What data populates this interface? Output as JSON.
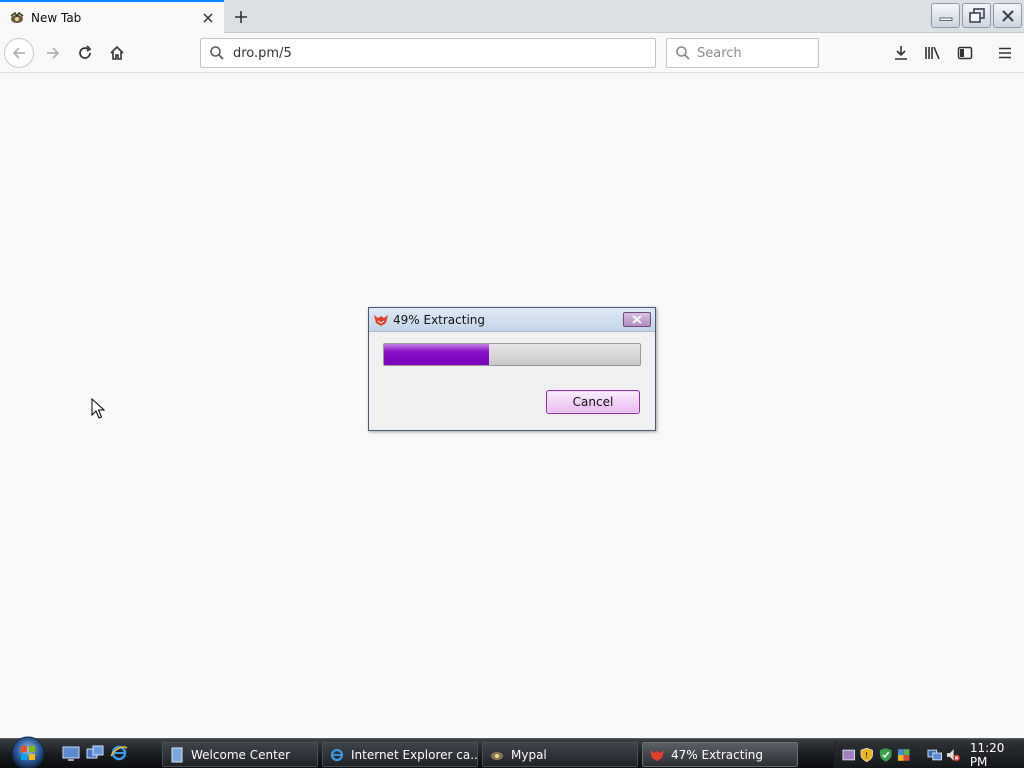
{
  "browser": {
    "tab": {
      "title": "New Tab",
      "close_icon": "close-icon",
      "favicon": "mypal-icon"
    },
    "new_tab_icon": "plus-icon",
    "nav": {
      "back_icon": "back-arrow-icon",
      "forward_icon": "forward-arrow-icon",
      "reload_icon": "reload-icon",
      "home_icon": "home-icon"
    },
    "url": {
      "value": "dro.pm/5"
    },
    "search": {
      "placeholder": "Search"
    },
    "toolbar_icons": [
      "download-icon",
      "library-icon",
      "sidebar-icon",
      "menu-icon"
    ],
    "window_controls": [
      "minimize-icon",
      "restore-icon",
      "close-icon"
    ]
  },
  "dialog": {
    "title": "49% Extracting",
    "progress_percent": 49,
    "cancel_label": "Cancel",
    "accent_color": "#7a00bb"
  },
  "taskbar": {
    "items": [
      {
        "label": "Welcome Center"
      },
      {
        "label": "Internet Explorer ca..."
      },
      {
        "label": "Mypal"
      },
      {
        "label": "47% Extracting"
      }
    ],
    "clock": "11:20 PM"
  }
}
